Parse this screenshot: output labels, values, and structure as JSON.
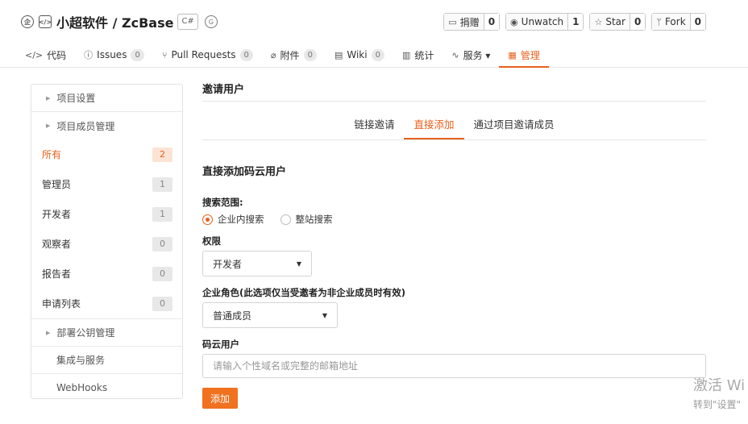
{
  "repo": {
    "title": "小超软件 / ZcBase",
    "lang": "C#",
    "ent_icon": "企",
    "code_icon": "</>",
    "gvp_icon": "G"
  },
  "actions": [
    {
      "icon": "▭",
      "label": "捐赠",
      "count": "0"
    },
    {
      "icon": "◉",
      "label": "Unwatch",
      "count": "1"
    },
    {
      "icon": "☆",
      "label": "Star",
      "count": "0"
    },
    {
      "icon": "ᛘ",
      "label": "Fork",
      "count": "0"
    }
  ],
  "nav": [
    {
      "icon": "</>",
      "label": "代码",
      "badge": ""
    },
    {
      "icon": "ⓘ",
      "label": "Issues",
      "badge": "0"
    },
    {
      "icon": "⑂",
      "label": "Pull Requests",
      "badge": "0"
    },
    {
      "icon": "⌀",
      "label": "附件",
      "badge": "0"
    },
    {
      "icon": "▤",
      "label": "Wiki",
      "badge": "0"
    },
    {
      "icon": "▥",
      "label": "统计",
      "badge": ""
    },
    {
      "icon": "∿",
      "label": "服务 ▾",
      "badge": ""
    },
    {
      "icon": "▦",
      "label": "管理",
      "badge": ""
    }
  ],
  "sidebar": {
    "project_settings": "项目设置",
    "member_mgmt": "项目成员管理",
    "items": [
      {
        "label": "所有",
        "count": "2"
      },
      {
        "label": "管理员",
        "count": "1"
      },
      {
        "label": "开发者",
        "count": "1"
      },
      {
        "label": "观察者",
        "count": "0"
      },
      {
        "label": "报告者",
        "count": "0"
      },
      {
        "label": "申请列表",
        "count": "0"
      }
    ],
    "deploy_keys": "部署公钥管理",
    "integrations": "集成与服务",
    "webhooks": "WebHooks"
  },
  "main": {
    "title": "邀请用户",
    "tabs": [
      "链接邀请",
      "直接添加",
      "通过项目邀请成员"
    ],
    "section_title": "直接添加码云用户",
    "search_scope_label": "搜索范围:",
    "scope_options": [
      "企业内搜索",
      "整站搜索"
    ],
    "permission_label": "权限",
    "permission_value": "开发者",
    "role_label": "企业角色(此选项仅当受邀者为非企业成员时有效)",
    "role_value": "普通成员",
    "user_label": "码云用户",
    "user_placeholder": "请输入个性域名或完整的邮箱地址",
    "add_button": "添加"
  },
  "watermark": {
    "line1": "激活 Wi",
    "line2": "转到\"设置\""
  }
}
